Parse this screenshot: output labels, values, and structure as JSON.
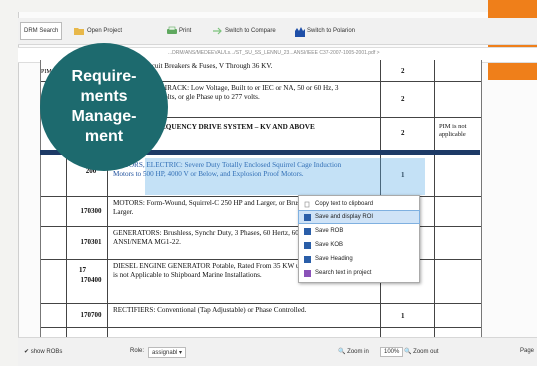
{
  "toolbar": {
    "tabs": [
      {
        "label": "DRM Search",
        "icon": "none"
      },
      {
        "label": "Open Project",
        "icon": "folder-icon"
      },
      {
        "label": "Print",
        "icon": "printer-icon"
      },
      {
        "label": "Switch to Compare",
        "icon": "compare-icon"
      },
      {
        "label": "Switch to Polarion",
        "icon": "polarion-icon"
      }
    ]
  },
  "path": {
    "text": "...DRM/ANS/MEDEEVAL/Ls.../ST_SU_SS_LENNU_23...ANSI/IEEE C37-2007-1005-2001.pdf >"
  },
  "badge": {
    "text": "Require-ments Manage-ment",
    "color": "#1d6a6e"
  },
  "accent": {
    "orange": "#ef7f1a",
    "blue_band": "#1d3a66"
  },
  "table": {
    "group_number": "17",
    "rows": [
      {
        "num": "",
        "desc": "Mounted, Circuit Breakers & Fuses, V Through 36 KV.",
        "count": "2",
        "note": ""
      },
      {
        "num": "",
        "desc": "TDOOR SWITCHRACK: Low Voltage, Built to er IEC or NA, 50 or 60 Hz, 3 Phase up to 480 volts, or gle Phase up to 277 volts.",
        "count": "2",
        "note": ""
      },
      {
        "num": "",
        "desc": "JUSTABLE FREQUENCY DRIVE SYSTEM – KV AND ABOVE",
        "count": "2",
        "note": "PIM is not applicable"
      },
      {
        "num": "200",
        "desc": "MOTORS, ELECTRIC: Severe Duty Totally Enclosed Squirrel Cage Induction Motors to 500 HP, 4000 V or Below, and Explosion Proof Motors.",
        "count": "1",
        "note": ""
      },
      {
        "num": "170300",
        "desc": "MOTORS: Form-Wound, Squirrel-C 250 HP and Larger, or Brushless Syn Larger.",
        "count": "",
        "note": ""
      },
      {
        "num": "170301",
        "desc": "GENERATORS: Brushless, Synchr Duty, 3 Phases, 60 Hertz, 600 to 650 ANSI/NEMA MG1-22.",
        "count": "",
        "note": ""
      },
      {
        "num": "170400",
        "desc": "DIESEL ENGINE GENERATOR Potable, Rated From 35 KW up to a KW. This is not Applicable to Shipboard Marine Installations.",
        "count": "2",
        "note": ""
      },
      {
        "num": "170700",
        "desc": "RECTIFIERS: Conventional (Tap Adjustable) or Phase Controlled.",
        "count": "1",
        "note": ""
      }
    ],
    "partial_note": "PIM is not"
  },
  "context_menu": {
    "items": [
      {
        "label": "Copy text to clipboard",
        "icon": "copy-icon"
      },
      {
        "label": "Save and display ROI",
        "icon": "save-display-icon"
      },
      {
        "label": "Save ROB",
        "icon": "save-rob-icon"
      },
      {
        "label": "Save KOB",
        "icon": "save-kob-icon"
      },
      {
        "label": "Save Heading",
        "icon": "save-heading-icon"
      },
      {
        "label": "Search text in project",
        "icon": "search-project-icon"
      }
    ],
    "selected_index": 1
  },
  "status": {
    "show_robs": "show ROBs",
    "role_label": "Role:",
    "role_value": "assignabl",
    "zoom_in": "Zoom in",
    "zoom_level": "100%",
    "zoom_out": "Zoom out",
    "page_label": "Page"
  }
}
